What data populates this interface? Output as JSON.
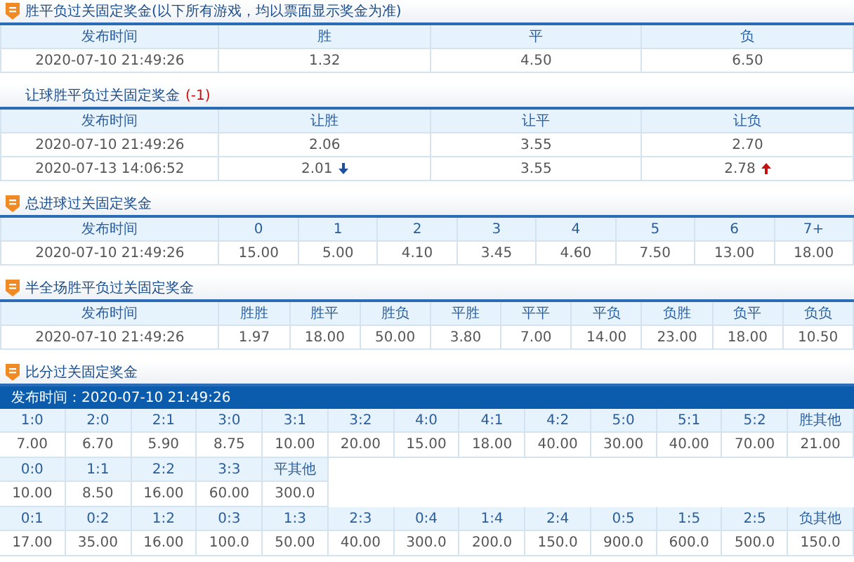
{
  "sections": [
    {
      "kind": "table",
      "title": "胜平负过关固定奖金(以下所有游戏，均以票面显示奖金为准)",
      "icon": true,
      "columns": [
        "发布时间",
        "胜",
        "平",
        "负"
      ],
      "rows": [
        [
          "2020-07-10 21:49:26",
          "1.32",
          "4.50",
          "6.50"
        ]
      ]
    },
    {
      "kind": "table",
      "title": "让球胜平负过关固定奖金",
      "badge": "(-1)",
      "icon": false,
      "columns": [
        "发布时间",
        "让胜",
        "让平",
        "让负"
      ],
      "rows": [
        [
          "2020-07-10 21:49:26",
          "2.06",
          "3.55",
          "2.70"
        ],
        [
          "2020-07-13 14:06:52",
          {
            "text": "2.01",
            "rising": false
          },
          "3.55",
          {
            "text": "2.78",
            "rising": true
          }
        ]
      ]
    },
    {
      "kind": "table",
      "title": "总进球过关固定奖金",
      "icon": true,
      "columns": [
        "发布时间",
        "0",
        "1",
        "2",
        "3",
        "4",
        "5",
        "6",
        "7+"
      ],
      "rows": [
        [
          "2020-07-10 21:49:26",
          "15.00",
          "5.00",
          "4.10",
          "3.45",
          "4.60",
          "7.50",
          "13.00",
          "18.00"
        ]
      ]
    },
    {
      "kind": "table",
      "title": "半全场胜平负过关固定奖金",
      "icon": true,
      "columns": [
        "发布时间",
        "胜胜",
        "胜平",
        "胜负",
        "平胜",
        "平平",
        "平负",
        "负胜",
        "负平",
        "负负"
      ],
      "rows": [
        [
          "2020-07-10 21:49:26",
          "1.97",
          "18.00",
          "50.00",
          "3.80",
          "7.00",
          "14.00",
          "23.00",
          "18.00",
          "10.50"
        ]
      ]
    },
    {
      "kind": "score",
      "title": "比分过关固定奖金",
      "icon": true,
      "published": "发布时间：2020-07-10 21:49:26",
      "groups": [
        {
          "labels": [
            "1:0",
            "2:0",
            "2:1",
            "3:0",
            "3:1",
            "3:2",
            "4:0",
            "4:1",
            "4:2",
            "5:0",
            "5:1",
            "5:2",
            "胜其他"
          ],
          "values": [
            "7.00",
            "6.70",
            "5.90",
            "8.75",
            "10.00",
            "20.00",
            "15.00",
            "18.00",
            "40.00",
            "30.00",
            "40.00",
            "70.00",
            "21.00"
          ]
        },
        {
          "labels": [
            "0:0",
            "1:1",
            "2:2",
            "3:3",
            "平其他"
          ],
          "values": [
            "10.00",
            "8.50",
            "16.00",
            "60.00",
            "300.0"
          ]
        },
        {
          "labels": [
            "0:1",
            "0:2",
            "1:2",
            "0:3",
            "1:3",
            "2:3",
            "0:4",
            "1:4",
            "2:4",
            "0:5",
            "1:5",
            "2:5",
            "负其他"
          ],
          "values": [
            "17.00",
            "35.00",
            "16.00",
            "100.0",
            "50.00",
            "40.00",
            "300.0",
            "200.0",
            "150.0",
            "900.0",
            "600.0",
            "500.0",
            "150.0"
          ]
        }
      ]
    }
  ]
}
